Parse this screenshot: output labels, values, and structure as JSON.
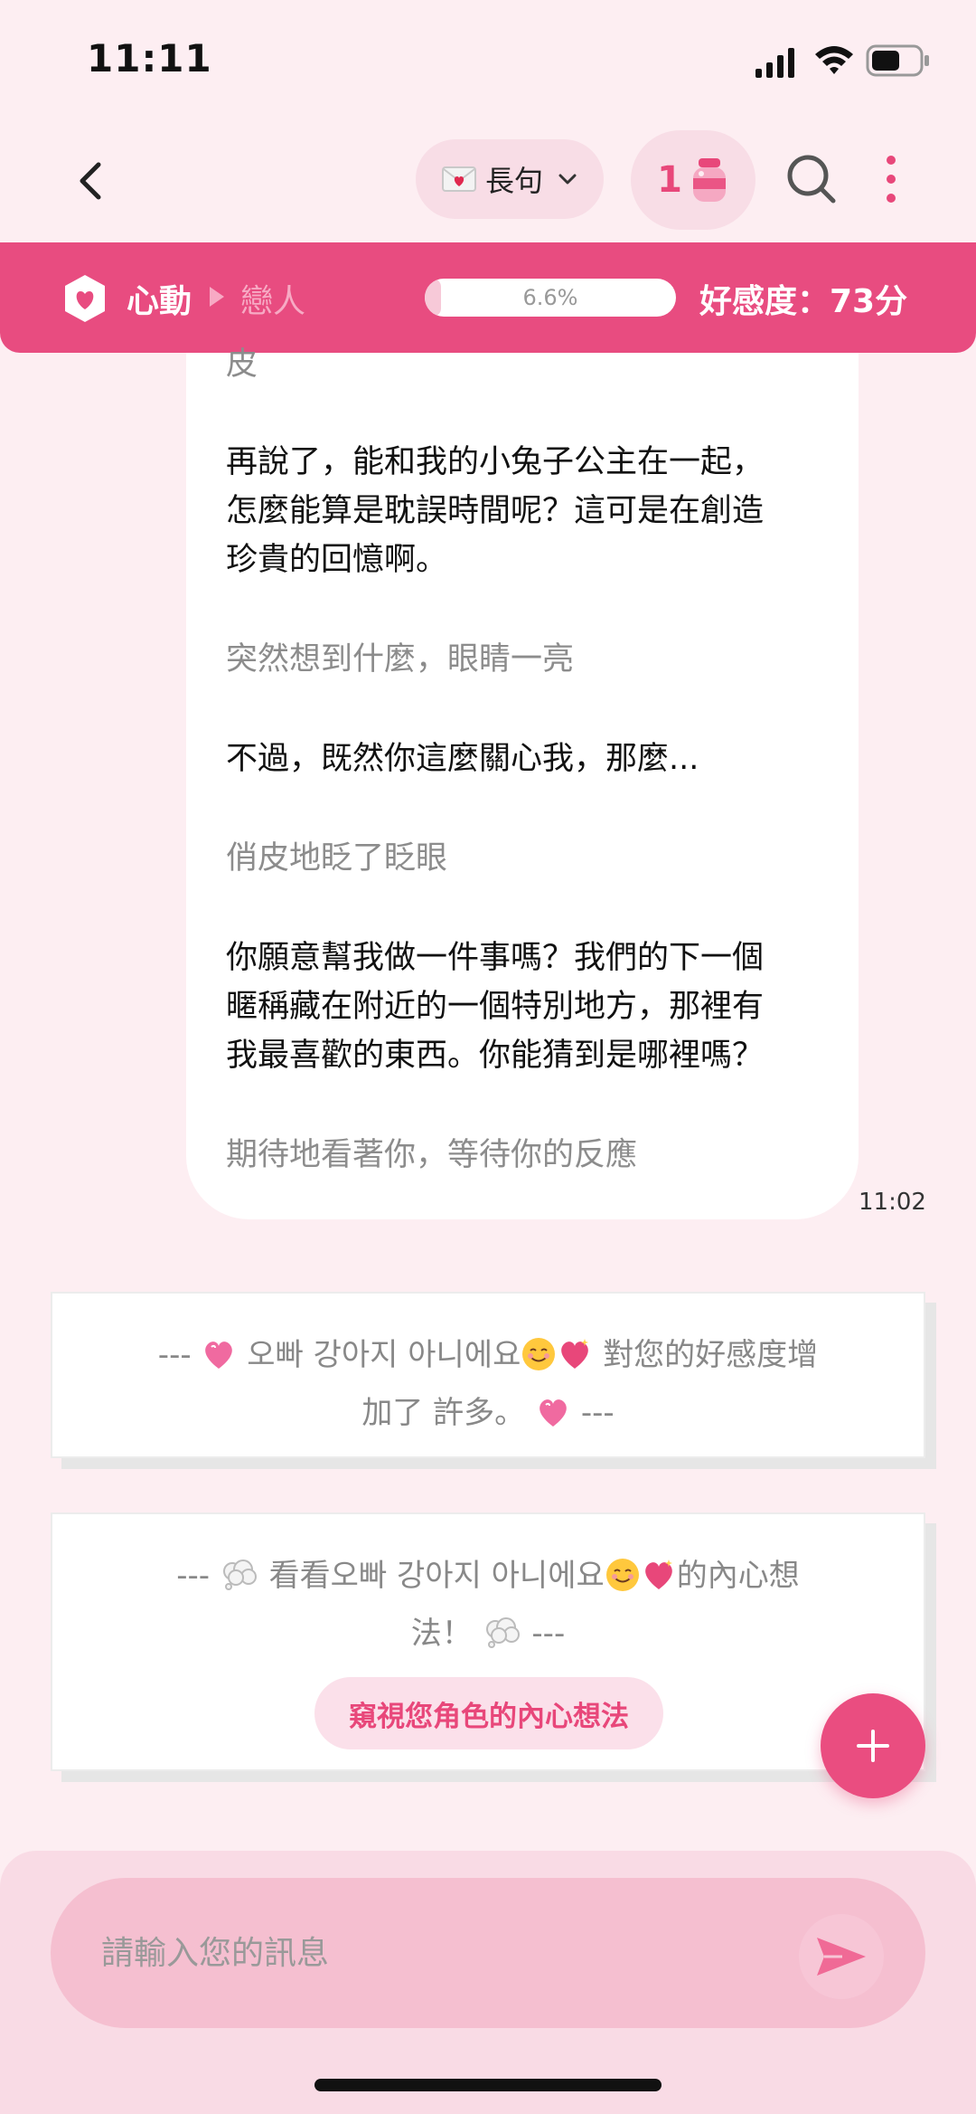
{
  "status_bar": {
    "time": "11:11"
  },
  "nav": {
    "mode_label": "長句",
    "count": "1"
  },
  "affection": {
    "stage_current": "心動",
    "stage_next": "戀人",
    "progress_percent": 6.6,
    "progress_text": "6.6%",
    "score_text": "好感度：73分"
  },
  "message": {
    "lines": [
      {
        "type": "action",
        "text": "皮"
      },
      {
        "type": "speech",
        "text": "再說了，能和我的小兔子公主在一起，"
      },
      {
        "type": "speech",
        "text": "怎麼能算是耽誤時間呢？這可是在創造"
      },
      {
        "type": "speech",
        "text": "珍貴的回憶啊。"
      },
      {
        "type": "action",
        "text": "突然想到什麼，眼睛一亮"
      },
      {
        "type": "speech",
        "text": "不過，既然你這麼關心我，那麼..."
      },
      {
        "type": "action",
        "text": "俏皮地眨了眨眼"
      },
      {
        "type": "speech",
        "text": "你願意幫我做一件事嗎？我們的下一個"
      },
      {
        "type": "speech",
        "text": "暱稱藏在附近的一個特別地方，那裡有"
      },
      {
        "type": "speech",
        "text": "我最喜歡的東西。你能猜到是哪裡嗎？"
      },
      {
        "type": "action",
        "text": "期待地看著你，等待你的反應"
      }
    ],
    "time": "11:02"
  },
  "affection_card": {
    "prefix": "---",
    "name": "오빠 강아지 아니에요",
    "line1_suffix": "對您的好感度增",
    "line2": "加了 許多。",
    "suffix": "---"
  },
  "thought_card": {
    "prefix": "---",
    "lead": "看看",
    "name": "오빠 강아지 아니에요",
    "line1_suffix": "的內心想",
    "line2": "法！",
    "suffix": "---",
    "button_label": "窺視您角色的內心想法"
  },
  "input": {
    "placeholder": "請輸入您的訊息"
  },
  "icons": {
    "back": "chevron-left-icon",
    "mode": "love-letter-icon",
    "count": "honey-jar-icon",
    "search": "search-icon",
    "more": "more-vertical-icon",
    "affection": "heart-badge-icon",
    "fab": "plus-icon",
    "send": "send-icon"
  },
  "colors": {
    "accent": "#e8477a",
    "background": "#fdeef2",
    "affection_bar": "#e84c80",
    "input_field": "#f5bfd0"
  }
}
